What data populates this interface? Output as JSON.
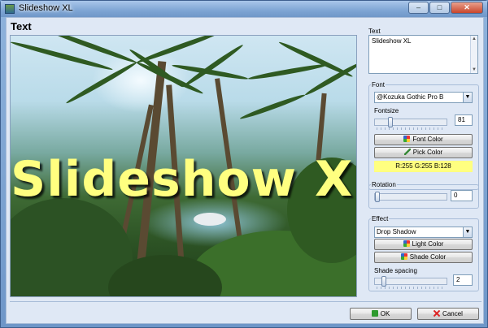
{
  "window": {
    "title": "Slideshow XL",
    "minimize": "–",
    "maximize": "□",
    "close": "✕"
  },
  "heading": "Text",
  "preview": {
    "overlay_text": "Slideshow XL",
    "overlay_color": "#ffff80"
  },
  "text_section": {
    "label": "Text",
    "value": "Slideshow XL"
  },
  "font_group": {
    "legend": "Font",
    "font_name": "@Kozuka Gothic Pro B",
    "fontsize_label": "Fontsize",
    "fontsize_value": "81",
    "fontsize_fraction": 0.2,
    "font_color_button": "Font Color",
    "pick_color_button": "Pick Color",
    "color_readout": "R:255  G:255  B:128",
    "color_hex": "#ffff80"
  },
  "rotation_group": {
    "legend": "Rotation",
    "value": "0",
    "fraction": 0.0
  },
  "effect_group": {
    "legend": "Effect",
    "effect_value": "Drop Shadow",
    "light_color_button": "Light Color",
    "shade_color_button": "Shade Color",
    "shade_spacing_label": "Shade spacing",
    "shade_spacing_value": "2",
    "shade_spacing_fraction": 0.1
  },
  "footer": {
    "ok_button": "OK",
    "cancel_button": "Cancel"
  }
}
